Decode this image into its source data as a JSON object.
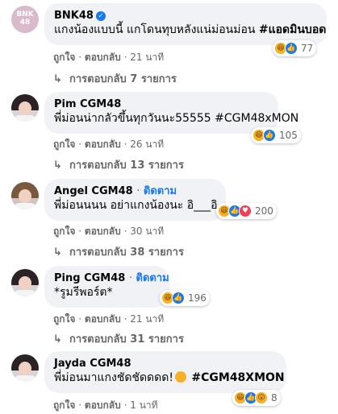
{
  "comments": [
    {
      "name": "BNK48",
      "avatar_text": "BNK\n48",
      "verified": true,
      "text": "แกงน้องแบบนี้ แกโดนทุบหลังแน่ม่อนม่อน",
      "tag": "#แอดมินบอด",
      "like_label": "ถูกใจ",
      "reply_label": "ตอบกลับ",
      "time": "21 นาที",
      "replies_label": "การตอบกลับ 7 รายการ",
      "reaction_count": "77"
    },
    {
      "name": "Pim CGM48",
      "text": "พี่ม่อนน่ากลัวขึ้นทุกวันนะ55555 #CGM48xMON",
      "like_label": "ถูกใจ",
      "reply_label": "ตอบกลับ",
      "time": "26 นาที",
      "replies_label": "การตอบกลับ 13 รายการ",
      "reaction_count": "105"
    },
    {
      "name": "Angel CGM48",
      "follow_label": "ติดตาม",
      "text": "พี่ม่อนนนน อย่าแกงน้องนะ อิ___อิ",
      "like_label": "ถูกใจ",
      "reply_label": "ตอบกลับ",
      "time": "30 นาที",
      "replies_label": "การตอบกลับ 38 รายการ",
      "reaction_count": "200"
    },
    {
      "name": "Ping CGM48",
      "follow_label": "ติดตาม",
      "text": "*รูมรีพอร์ต*",
      "like_label": "ถูกใจ",
      "reply_label": "ตอบกลับ",
      "time": "21 นาที",
      "replies_label": "การตอบกลับ 31 รายการ",
      "reaction_count": "196"
    },
    {
      "name": "Jayda CGM48",
      "text": "พี่ม่อนมาแกงชัดชัดดดด!",
      "tag": "#CGM48XMON",
      "like_label": "ถูกใจ",
      "reply_label": "ตอบกลับ",
      "time": "1 นาที",
      "reaction_count": "8"
    }
  ],
  "separator": "·",
  "icons": {
    "verified": "verified-badge-icon",
    "reply_arrow": "reply-arrow-icon",
    "haha": "haha-reaction-icon",
    "like": "like-reaction-icon",
    "love": "love-reaction-icon",
    "wow": "wow-reaction-icon"
  },
  "colors": {
    "bubble": "#f0f2f5",
    "link": "#1877f2",
    "muted": "#65676b"
  }
}
